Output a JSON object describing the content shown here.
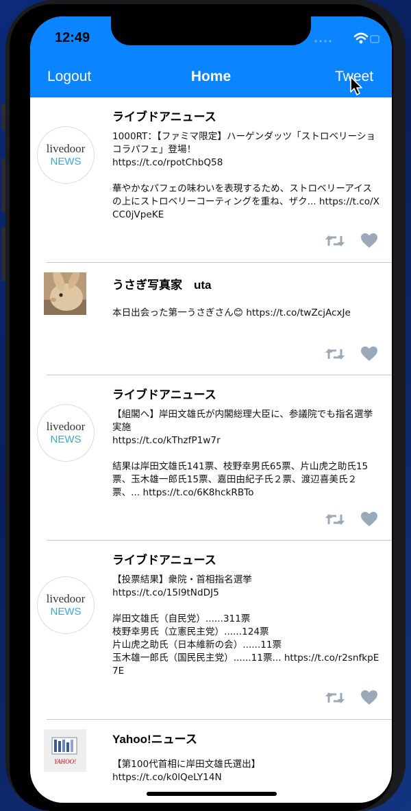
{
  "status_bar": {
    "time": "12:49"
  },
  "nav": {
    "logout_label": "Logout",
    "title": "Home",
    "tweet_label": "Tweet"
  },
  "avatars": {
    "livedoor_top": "livedoor",
    "livedoor_bottom": "NEWS",
    "yahoo_logo": "YAHOO!"
  },
  "tweets": [
    {
      "name": "ライブドアニュース",
      "text": "1000RT：【ファミマ限定】ハーゲンダッツ「ストロベリーショコラパフェ」登場！\nhttps://t.co/rpotChbQ58\n\n華やかなパフェの味わいを表現するため、ストロベリーアイスの上にストロベリーコーティングを重ね、ザク... https://t.co/XCC0jVpeKE"
    },
    {
      "name": "うさぎ写真家　uta",
      "text": "本日出会った第一うさぎさん😊 https://t.co/twZcjAcxJe"
    },
    {
      "name": "ライブドアニュース",
      "text": "【組閣へ】岸田文雄氏が内閣総理大臣に、参議院でも指名選挙実施\nhttps://t.co/kThzfP1w7r\n\n結果は岸田文雄氏141票、枝野幸男氏65票、片山虎之助氏15票、玉木雄一郎氏15票、嘉田由紀子氏２票、渡辺喜美氏２票、... https://t.co/6K8hckRBTo"
    },
    {
      "name": "ライブドアニュース",
      "text": "【投票結果】衆院・首相指名選挙\nhttps://t.co/15l9tNdDJ5\n\n岸田文雄氏（自民党）......311票\n枝野幸男氏（立憲民主党）......124票\n片山虎之助氏（日本維新の会）......11票\n玉木雄一郎氏（国民民主党）......11票... https://t.co/r2snfkpE7E"
    },
    {
      "name": "Yahoo!ニュース",
      "text": "【第100代首相に岸田文雄氏選出】\nhttps://t.co/k0lQeLY14N"
    }
  ],
  "colors": {
    "accent": "#0a84ff",
    "action_icon": "#9aa9b8"
  }
}
